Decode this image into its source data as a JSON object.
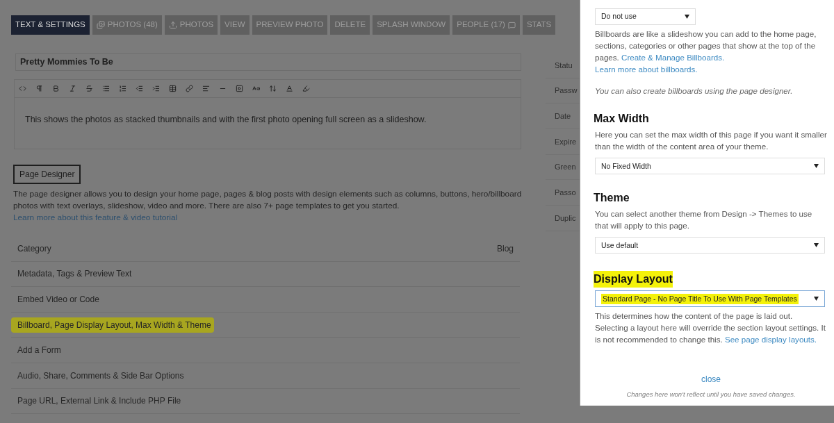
{
  "tabs": [
    {
      "label": "TEXT & SETTINGS",
      "selected": true,
      "kind": "plain"
    },
    {
      "label": "PHOTOS (48)",
      "selected": false,
      "kind": "gallery"
    },
    {
      "label": "PHOTOS",
      "selected": false,
      "kind": "upload"
    },
    {
      "label": "VIEW",
      "selected": false,
      "kind": "plain"
    },
    {
      "label": "PREVIEW PHOTO",
      "selected": false,
      "kind": "plain"
    },
    {
      "label": "DELETE",
      "selected": false,
      "kind": "plain"
    },
    {
      "label": "SPLASH WINDOW",
      "selected": false,
      "kind": "plain"
    },
    {
      "label": "PEOPLE (17)",
      "selected": false,
      "kind": "chat"
    },
    {
      "label": "STATS",
      "selected": false,
      "kind": "plain"
    }
  ],
  "title_field": {
    "value": "Pretty Mommies To Be"
  },
  "editor": {
    "text": "This shows the photos as stacked thumbnails and with the first photo opening full screen as a slideshow."
  },
  "page_designer": {
    "button": "Page Designer",
    "description": "The page designer allows you to design your home page, pages & blog posts with design elements such as columns, buttons, hero/billboard photos with text overlays, slideshow, video and more. There are also 7+ page templates to get you started.",
    "link": "Learn more about this feature & video tutorial"
  },
  "sections": [
    {
      "label": "Category",
      "value": "Blog",
      "highlighted": false
    },
    {
      "label": "Metadata, Tags & Preview Text",
      "highlighted": false
    },
    {
      "label": "Embed Video or Code",
      "highlighted": false
    },
    {
      "label": "Billboard, Page Display Layout, Max Width & Theme",
      "highlighted": true
    },
    {
      "label": "Add a Form",
      "highlighted": false
    },
    {
      "label": "Audio, Share, Comments & Side Bar Options",
      "highlighted": false
    },
    {
      "label": "Page URL, External Link & Include PHP File",
      "highlighted": false
    }
  ],
  "side_labels": [
    "Statu",
    "Passw",
    "Date",
    "Expire",
    "Green",
    "Passo",
    "Duplic"
  ],
  "panel": {
    "billboard": {
      "select": "Do not use",
      "description": "Billboards are like a slideshow you can add to the home page, sections, categories or other pages that show at the top of the pages.",
      "links": [
        "Create & Manage Billboards.",
        "Learn more about billboards."
      ],
      "note": "You can also create billboards using the page designer."
    },
    "max_width": {
      "heading": "Max Width",
      "description": "Here you can set the max width of this page if you want it smaller than the width of the content area of your theme.",
      "select": "No Fixed Width"
    },
    "theme": {
      "heading": "Theme",
      "description": "You can select another theme from Design -> Themes to use that will apply to this page.",
      "select": "Use default"
    },
    "display_layout": {
      "heading": "Display Layout",
      "highlighted": true,
      "select": "Standard Page - No Page Title To Use With Page Templates",
      "description": "This determines how the content of the page is laid out. Selecting a layout here will override the section layout settings. It is not recommended to change this.",
      "link": "See page display layouts."
    },
    "close": "close",
    "footnote": "Changes here won't reflect until you have saved changes."
  }
}
